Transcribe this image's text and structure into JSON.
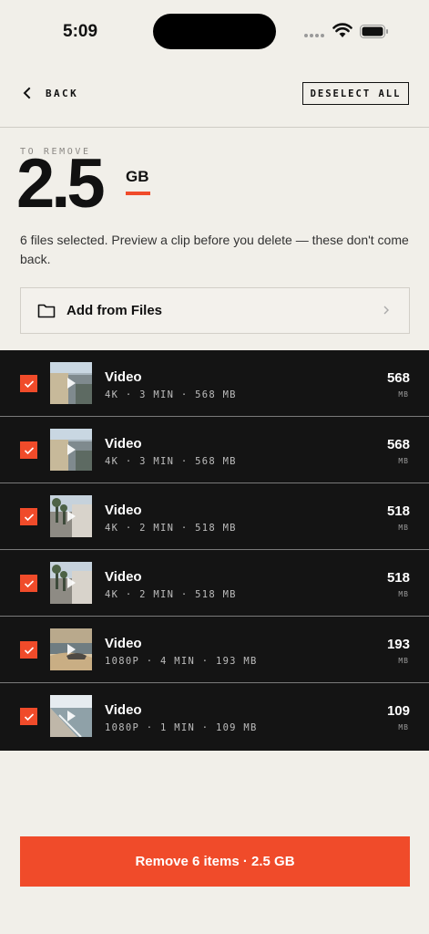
{
  "status_bar": {
    "time": "5:09"
  },
  "nav": {
    "back_label": "BACK",
    "deselect_label": "DESELECT ALL"
  },
  "summary": {
    "label": "TO REMOVE",
    "amount": "2.5",
    "unit": "GB",
    "description": "6 files selected. Preview a clip before you delete — these don't come back."
  },
  "add_files": {
    "label": "Add from Files"
  },
  "files": [
    {
      "title": "Video",
      "meta": "4K · 3 MIN · 568 MB",
      "size": "568",
      "unit": "MB",
      "checked": true
    },
    {
      "title": "Video",
      "meta": "4K · 3 MIN · 568 MB",
      "size": "568",
      "unit": "MB",
      "checked": true
    },
    {
      "title": "Video",
      "meta": "4K · 2 MIN · 518 MB",
      "size": "518",
      "unit": "MB",
      "checked": true
    },
    {
      "title": "Video",
      "meta": "4K · 2 MIN · 518 MB",
      "size": "518",
      "unit": "MB",
      "checked": true
    },
    {
      "title": "Video",
      "meta": "1080P · 4 MIN · 193 MB",
      "size": "193",
      "unit": "MB",
      "checked": true
    },
    {
      "title": "Video",
      "meta": "1080P · 1 MIN · 109 MB",
      "size": "109",
      "unit": "MB",
      "checked": true
    }
  ],
  "remove_button": {
    "label": "Remove 6 items · 2.5 GB"
  },
  "colors": {
    "accent": "#f04b2a",
    "background": "#f1efe9",
    "list_bg": "#141414"
  }
}
